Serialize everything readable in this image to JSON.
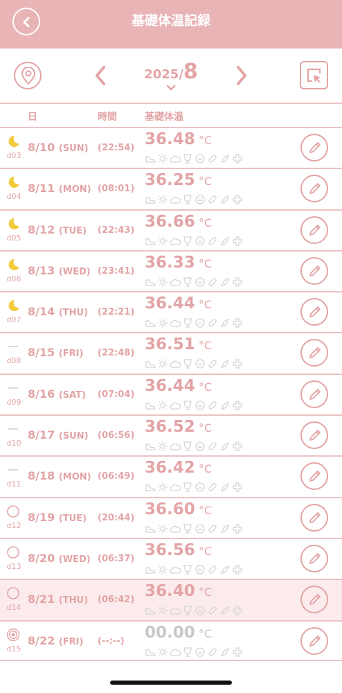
{
  "header": {
    "title": "基礎体温記録"
  },
  "month_nav": {
    "year": "2025/",
    "month": "8"
  },
  "columns": {
    "day": "日",
    "time": "時間",
    "temp": "基礎体温"
  },
  "unit": "°C",
  "colors": {
    "accent": "#e3a4a6",
    "header_bg": "#e8b4b6",
    "moon": "#f2cb3a",
    "highlight_bg": "#fbebec"
  },
  "rows": [
    {
      "phase": "moon",
      "day": "d03",
      "date": "8/10",
      "dow": "(SUN)",
      "time": "(22:54)",
      "temp": "36.48"
    },
    {
      "phase": "moon",
      "day": "d04",
      "date": "8/11",
      "dow": "(MON)",
      "time": "(08:01)",
      "temp": "36.25"
    },
    {
      "phase": "moon",
      "day": "d05",
      "date": "8/12",
      "dow": "(TUE)",
      "time": "(22:43)",
      "temp": "36.66"
    },
    {
      "phase": "moon",
      "day": "d06",
      "date": "8/13",
      "dow": "(WED)",
      "time": "(23:41)",
      "temp": "36.33"
    },
    {
      "phase": "moon",
      "day": "d07",
      "date": "8/14",
      "dow": "(THU)",
      "time": "(22:21)",
      "temp": "36.44"
    },
    {
      "phase": "dash",
      "day": "d08",
      "date": "8/15",
      "dow": "(FRI)",
      "time": "(22:48)",
      "temp": "36.51"
    },
    {
      "phase": "dash",
      "day": "d09",
      "date": "8/16",
      "dow": "(SAT)",
      "time": "(07:04)",
      "temp": "36.44"
    },
    {
      "phase": "dash",
      "day": "d10",
      "date": "8/17",
      "dow": "(SUN)",
      "time": "(06:56)",
      "temp": "36.52"
    },
    {
      "phase": "dash",
      "day": "d11",
      "date": "8/18",
      "dow": "(MON)",
      "time": "(06:49)",
      "temp": "36.42"
    },
    {
      "phase": "circle",
      "day": "d12",
      "date": "8/19",
      "dow": "(TUE)",
      "time": "(20:44)",
      "temp": "36.60"
    },
    {
      "phase": "circle",
      "day": "d13",
      "date": "8/20",
      "dow": "(WED)",
      "time": "(06:37)",
      "temp": "36.56"
    },
    {
      "phase": "circle",
      "day": "d14",
      "date": "8/21",
      "dow": "(THU)",
      "time": "(06:42)",
      "temp": "36.40"
    },
    {
      "phase": "target",
      "day": "d15",
      "date": "8/22",
      "dow": "(FRI)",
      "time": "(--:--)",
      "temp": "00.00"
    }
  ],
  "highlighted_day": "d14",
  "symptom_icons": [
    "sneaker-icon",
    "sun-icon",
    "cloud-icon",
    "wine-glass-icon",
    "face-icon",
    "pill-icon",
    "rocket-icon",
    "cross-icon"
  ]
}
